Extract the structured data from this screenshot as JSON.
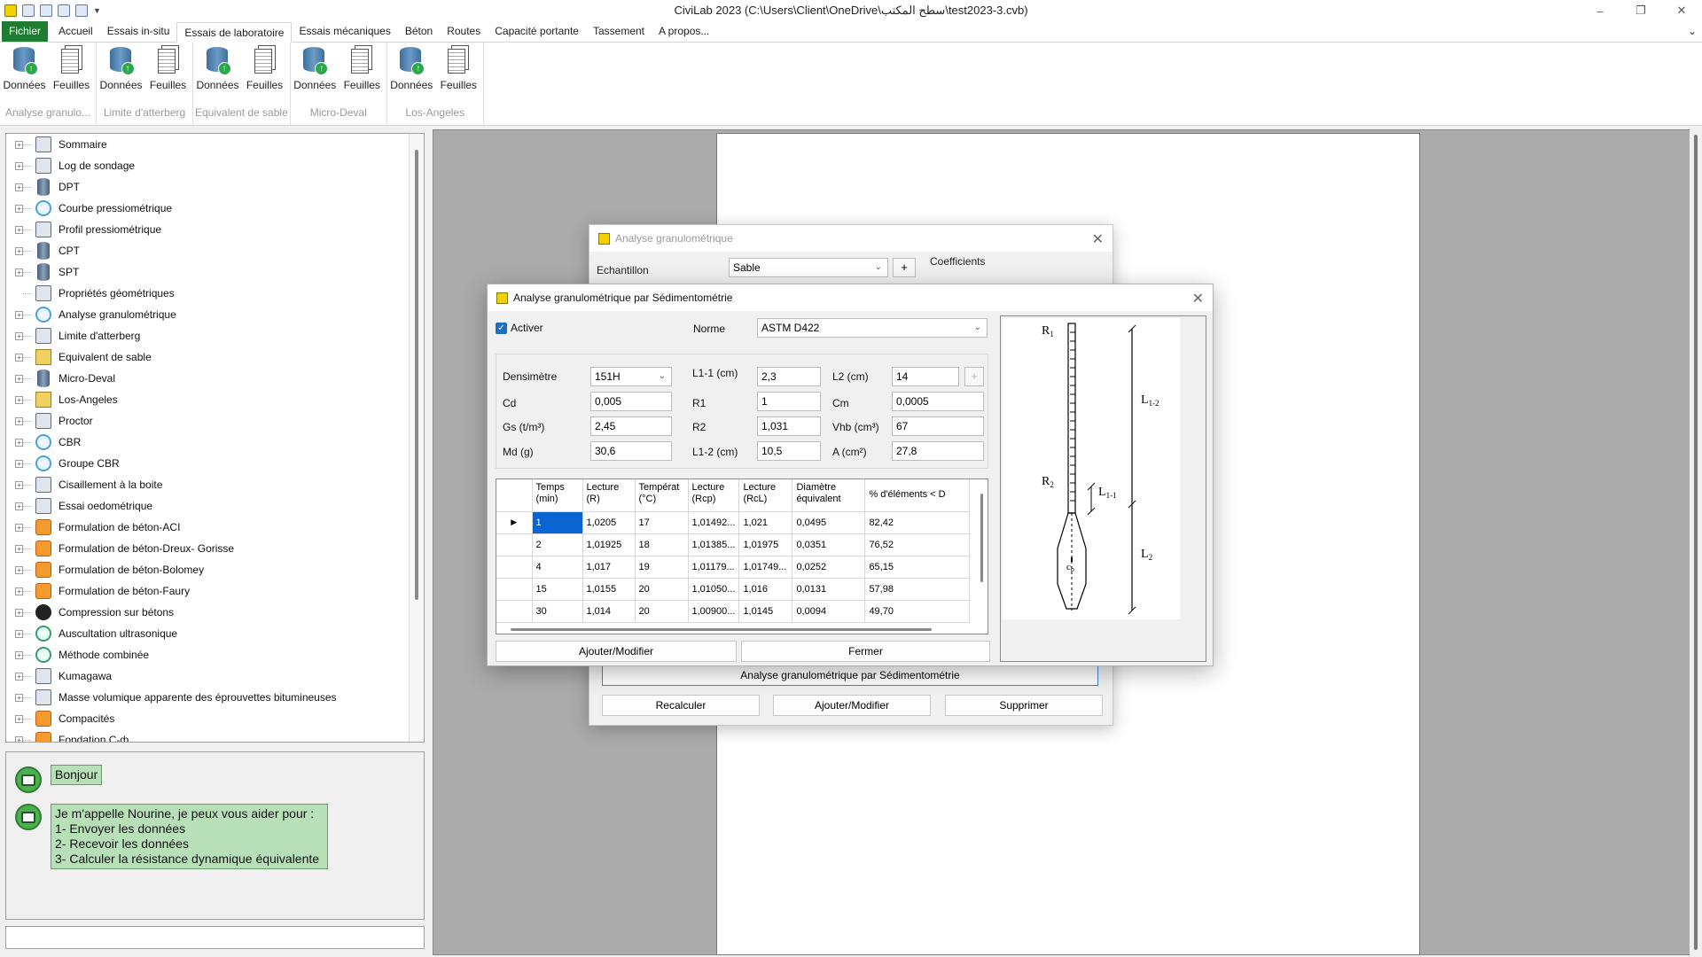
{
  "app": {
    "title": "CiviLab  2023 (C:\\Users\\Client\\OneDrive\\سطح المكتب\\test2023-3.cvb)"
  },
  "window_controls": {
    "minimize": "–",
    "restore": "❐",
    "close": "✕"
  },
  "ribbon": {
    "tabs": [
      {
        "label": "Fichier"
      },
      {
        "label": "Accueil"
      },
      {
        "label": "Essais in-situ"
      },
      {
        "label": "Essais de laboratoire"
      },
      {
        "label": "Essais mécaniques"
      },
      {
        "label": "Béton"
      },
      {
        "label": "Routes"
      },
      {
        "label": "Capacité portante"
      },
      {
        "label": "Tassement"
      },
      {
        "label": "A propos..."
      }
    ],
    "active_tab": "Essais de laboratoire",
    "collapse_icon": "⌄",
    "groups": [
      {
        "label": "Analyse granulo...",
        "btn1": "Données",
        "btn2": "Feuilles"
      },
      {
        "label": "Limite d'atterberg",
        "btn1": "Données",
        "btn2": "Feuilles"
      },
      {
        "label": "Equivalent de sable",
        "btn1": "Données",
        "btn2": "Feuilles"
      },
      {
        "label": "Micro-Deval",
        "btn1": "Données",
        "btn2": "Feuilles"
      },
      {
        "label": "Los-Angeles",
        "btn1": "Données",
        "btn2": "Feuilles"
      }
    ]
  },
  "tree": {
    "items": [
      {
        "label": "Sommaire",
        "icon": "gen"
      },
      {
        "label": "Log de sondage",
        "icon": "gen"
      },
      {
        "label": "DPT",
        "icon": "cyl"
      },
      {
        "label": "Courbe pressiométrique",
        "icon": "circle"
      },
      {
        "label": "Profil pressiométrique",
        "icon": "gen"
      },
      {
        "label": "CPT",
        "icon": "cyl"
      },
      {
        "label": "SPT",
        "icon": "cyl"
      },
      {
        "label": "Propriétés géométriques",
        "icon": "gen"
      },
      {
        "label": "Analyse granulométrique",
        "icon": "circle"
      },
      {
        "label": "Limite d'atterberg",
        "icon": "gen"
      },
      {
        "label": "Equivalent de sable",
        "icon": "yellow"
      },
      {
        "label": "Micro-Deval",
        "icon": "cyl"
      },
      {
        "label": "Los-Angeles",
        "icon": "yellow"
      },
      {
        "label": "Proctor",
        "icon": "gen"
      },
      {
        "label": "CBR",
        "icon": "circle"
      },
      {
        "label": "Groupe CBR",
        "icon": "circle"
      },
      {
        "label": "Cisaillement à la boite",
        "icon": "gen"
      },
      {
        "label": "Essai oedométrique",
        "icon": "gen"
      },
      {
        "label": "Formulation de béton-ACI",
        "icon": "orange"
      },
      {
        "label": "Formulation de béton-Dreux- Gorisse",
        "icon": "orange"
      },
      {
        "label": "Formulation de béton-Bolomey",
        "icon": "orange"
      },
      {
        "label": "Formulation de béton-Faury",
        "icon": "orange"
      },
      {
        "label": "Compression sur bétons",
        "icon": "black"
      },
      {
        "label": "Auscultation ultrasonique",
        "icon": "green"
      },
      {
        "label": "Méthode combinée",
        "icon": "green"
      },
      {
        "label": "Kumagawa",
        "icon": "gen"
      },
      {
        "label": "Masse volumique apparente des éprouvettes bitumineuses",
        "icon": "gen"
      },
      {
        "label": "Compacités",
        "icon": "orange"
      },
      {
        "label": "Fondation C-ф",
        "icon": "orange"
      }
    ]
  },
  "chat": {
    "greeting": "Bonjour",
    "lines": [
      "Je m'appelle Nourine, je peux vous aider pour :",
      "1- Envoyer les données",
      "2- Recevoir les données",
      "3- Calculer la résistance dynamique équivalente"
    ]
  },
  "bg_dialog": {
    "title": "Analyse granulométrique",
    "close": "✕",
    "echantillon_label": "Echantillon",
    "echantillon_value": "Sable",
    "plus": "+",
    "coefficients_label": "Coefficients",
    "sedimento_button": "Analyse granulométrique par Sédimentométrie",
    "recalculer": "Recalculer",
    "ajouter": "Ajouter/Modifier",
    "supprimer": "Supprimer"
  },
  "fg_dialog": {
    "title": "Analyse granulométrique par Sédimentométrie",
    "close": "✕",
    "activer_label": "Activer",
    "activer_checked": true,
    "norme_label": "Norme",
    "norme_value": "ASTM D422",
    "params": {
      "densimetre": {
        "label": "Densimètre",
        "value": "151H"
      },
      "cd": {
        "label": "Cd",
        "value": "0,005"
      },
      "gs": {
        "label": "Gs  (t/m³)",
        "value": "2,45"
      },
      "md": {
        "label": "Md (g)",
        "value": "30,6"
      },
      "l11": {
        "label": "L1-1 (cm)",
        "value": "2,3"
      },
      "r1": {
        "label": "R1",
        "value": "1"
      },
      "r2": {
        "label": "R2",
        "value": "1,031"
      },
      "l12": {
        "label": "L1-2 (cm)",
        "value": "10,5"
      },
      "l2": {
        "label": "L2 (cm)",
        "value": "14"
      },
      "cm": {
        "label": "Cm",
        "value": "0,0005"
      },
      "vhb": {
        "label": "Vhb (cm³)",
        "value": "67"
      },
      "a": {
        "label": "A (cm²)",
        "value": "27,8"
      }
    },
    "plus": "+",
    "grid": {
      "headers": [
        [
          "Temps",
          "(min)"
        ],
        [
          "Lecture",
          "(R)"
        ],
        [
          "Températ",
          "(°C)"
        ],
        [
          "Lecture",
          "(Rcp)"
        ],
        [
          "Lecture",
          "(RcL)"
        ],
        [
          "Diamètre",
          "équivalent"
        ],
        [
          "% d'éléments < D",
          ""
        ]
      ],
      "current_row_marker": "▶",
      "rows": [
        [
          "1",
          "1,0205",
          "17",
          "1,01492...",
          "1,021",
          "0,0495",
          "82,42"
        ],
        [
          "2",
          "1,01925",
          "18",
          "1,01385...",
          "1,01975",
          "0,0351",
          "76,52"
        ],
        [
          "4",
          "1,017",
          "19",
          "1,01179...",
          "1,01749...",
          "0,0252",
          "65,15"
        ],
        [
          "15",
          "1,0155",
          "20",
          "1,01050...",
          "1,016",
          "0,0131",
          "57,98"
        ],
        [
          "30",
          "1,014",
          "20",
          "1,00900...",
          "1,0145",
          "0,0094",
          "49,70"
        ]
      ]
    },
    "ajouter": "Ajouter/Modifier",
    "fermer": "Fermer",
    "diagram": {
      "r1": "R",
      "r1_sub": "1",
      "r2": "R",
      "r2_sub": "2",
      "l11": "L",
      "l11_sub": "1-1",
      "l12": "L",
      "l12_sub": "1-2",
      "l2": "L",
      "l2_sub": "2",
      "cb": "c",
      "cb_sub": "b"
    }
  }
}
